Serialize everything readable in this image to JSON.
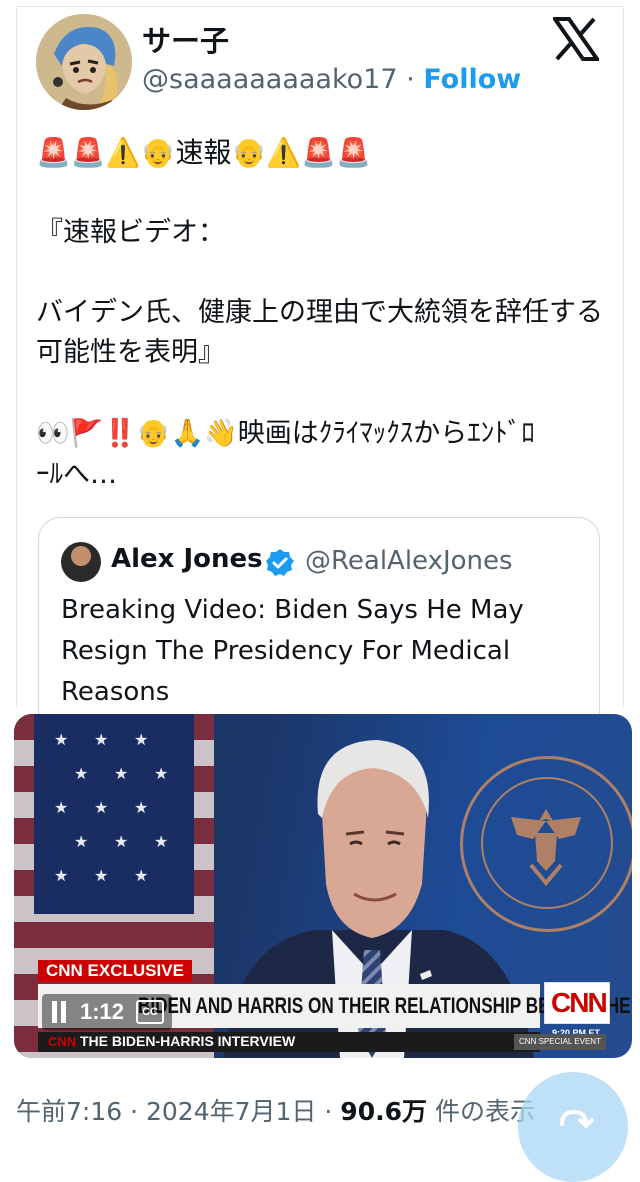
{
  "author": {
    "display_name": "サー子",
    "handle": "@saaaaaaaaako17",
    "separator": "·",
    "follow_label": "Follow"
  },
  "tweet": {
    "emoji_line": "🚨🚨⚠️👴速報👴⚠️🚨🚨",
    "line_1": "『速報ビデオ：",
    "line_2": "バイデン氏、健康上の理由で大統領を辞任する可能性を表明』",
    "emoji_line_2": "👀🚩‼️👴🙏👋映画はｸﾗｲﾏｯｸｽからｴﾝﾄﾞﾛ",
    "emoji_line_2b": "ｰﾙへ…"
  },
  "quoted": {
    "name": "Alex Jones",
    "handle": "@RealAlexJones",
    "text": "Breaking Video: Biden Says He May Resign The Presidency For Medical Reasons"
  },
  "video": {
    "badge": "CNN EXCLUSIVE",
    "headline": "BIDEN AND HARRIS ON THEIR RELATIONSHIP BEHIND THE SCENES",
    "network_logo": "CNN",
    "clock": "9:20 PM ET",
    "interview_logo": "CNN",
    "interview": "THE BIDEN-HARRIS INTERVIEW",
    "special_event": "CNN SPECIAL EVENT",
    "elapsed_time": "1:12",
    "cc_label": "CC"
  },
  "meta": {
    "time": "午前7:16",
    "date": "2024年7月1日",
    "views": "90.6万",
    "views_suffix": "件の表示",
    "sep": "·"
  },
  "colors": {
    "follow": "#1d9bf0",
    "verified": "#1d9bf0",
    "cnn_red": "#cc0000"
  }
}
